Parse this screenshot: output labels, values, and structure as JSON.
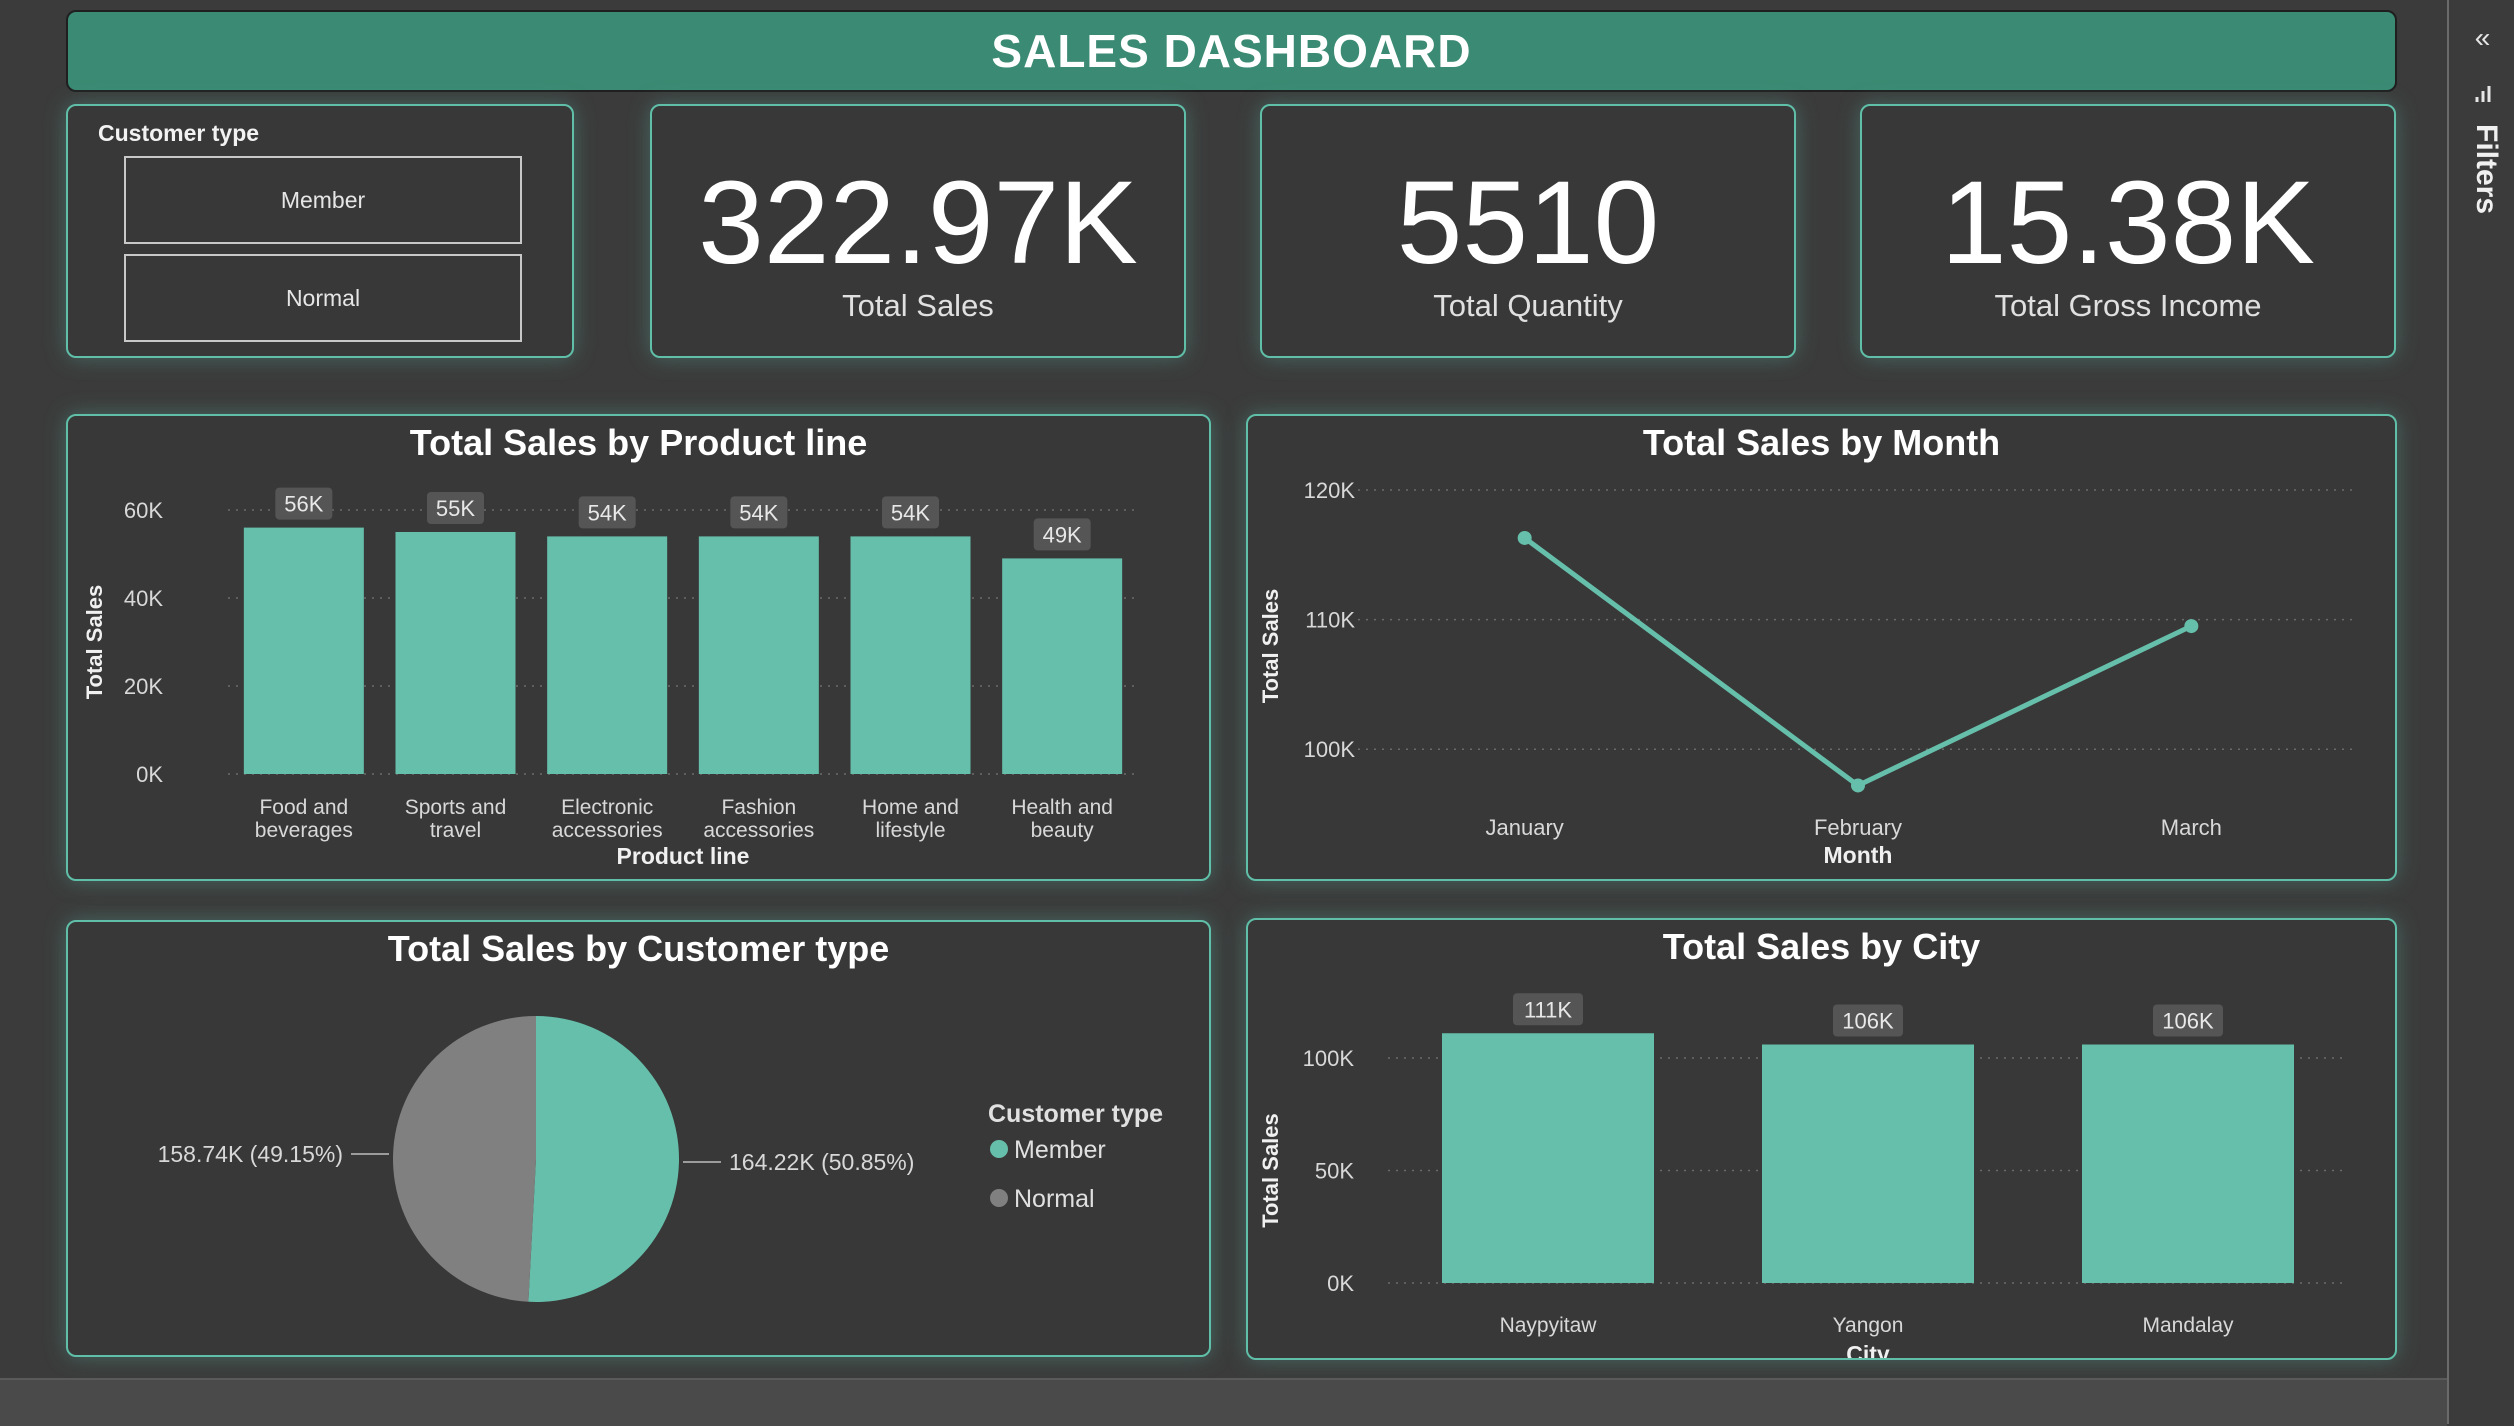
{
  "header": {
    "title": "SALES DASHBOARD"
  },
  "slicer": {
    "title": "Customer type",
    "options": [
      "Member",
      "Normal"
    ]
  },
  "kpis": [
    {
      "value": "322.97K",
      "label": "Total Sales"
    },
    {
      "value": "5510",
      "label": "Total Quantity"
    },
    {
      "value": "15.38K",
      "label": "Total Gross Income"
    }
  ],
  "filters": {
    "label": "Filters"
  },
  "colors": {
    "accent": "#66bfaa",
    "header": "#3b8a73",
    "background": "#3b3b3b",
    "normal": "#808080"
  },
  "chart_data": [
    {
      "type": "bar",
      "title": "Total Sales by Product line",
      "xlabel": "Product line",
      "ylabel": "Total Sales",
      "categories": [
        [
          "Food and",
          "beverages"
        ],
        [
          "Sports and",
          "travel"
        ],
        [
          "Electronic",
          "accessories"
        ],
        [
          "Fashion",
          "accessories"
        ],
        [
          "Home and",
          "lifestyle"
        ],
        [
          "Health and",
          "beauty"
        ]
      ],
      "values": [
        56,
        55,
        54,
        54,
        54,
        49
      ],
      "data_labels": [
        "56K",
        "55K",
        "54K",
        "54K",
        "54K",
        "49K"
      ],
      "yticks": [
        "0K",
        "20K",
        "40K",
        "60K"
      ],
      "ylim": [
        0,
        60
      ],
      "grid": true
    },
    {
      "type": "line",
      "title": "Total Sales by Month",
      "xlabel": "Month",
      "ylabel": "Total Sales",
      "categories": [
        "January",
        "February",
        "March"
      ],
      "values": [
        116.3,
        97.2,
        109.5
      ],
      "yticks": [
        "100K",
        "110K",
        "120K"
      ],
      "ylim": [
        97.7,
        120
      ],
      "grid": true
    },
    {
      "type": "pie",
      "title": "Total Sales by Customer type",
      "legend_title": "Customer type",
      "legend_placement": "right",
      "slices": [
        {
          "name": "Member",
          "value": 164.22,
          "label": "164.22K (50.85%)",
          "color": "#66bfaa"
        },
        {
          "name": "Normal",
          "value": 158.74,
          "label": "158.74K (49.15%)",
          "color": "#808080"
        }
      ]
    },
    {
      "type": "bar",
      "title": "Total Sales by City",
      "xlabel": "City",
      "ylabel": "Total Sales",
      "categories": [
        "Naypyitaw",
        "Yangon",
        "Mandalay"
      ],
      "values": [
        111,
        106,
        106
      ],
      "data_labels": [
        "111K",
        "106K",
        "106K"
      ],
      "yticks": [
        "0K",
        "50K",
        "100K"
      ],
      "ylim": [
        0,
        100
      ],
      "grid": true
    }
  ]
}
